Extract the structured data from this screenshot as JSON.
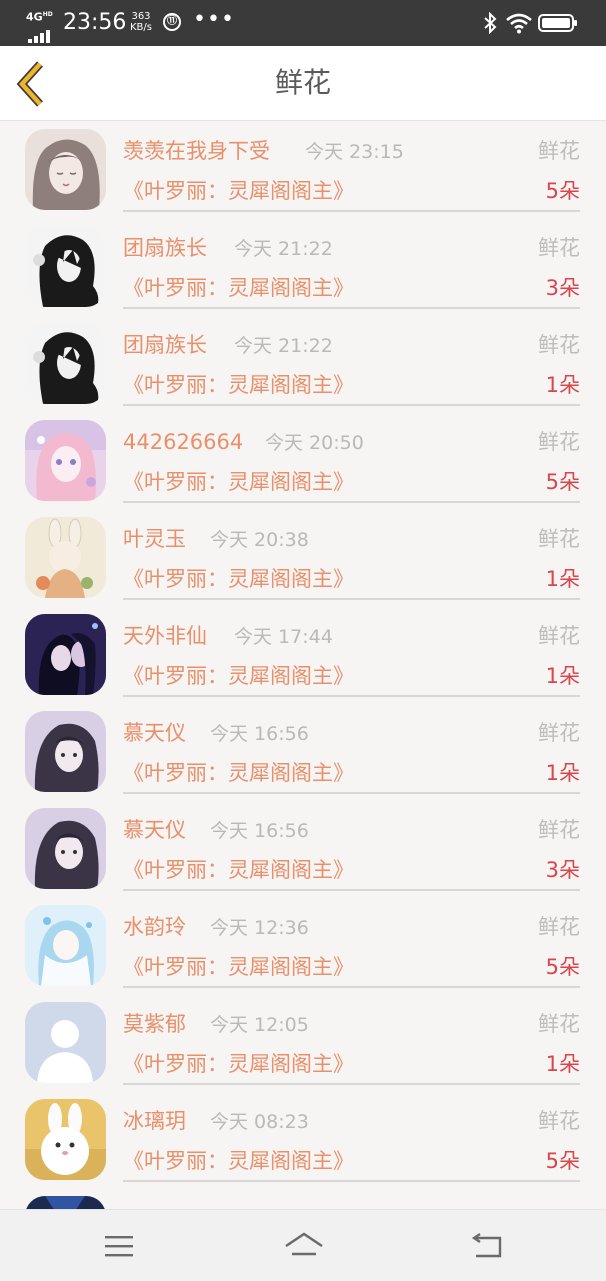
{
  "status_bar": {
    "network": "4G",
    "network_sup": "HD",
    "time": "23:56",
    "speed_value": "363",
    "speed_unit": "KB/s",
    "app_badge": "⑪",
    "more": "•••",
    "icons": [
      "signal-icon",
      "bluetooth-icon",
      "wifi-icon",
      "battery-icon"
    ]
  },
  "header": {
    "title": "鲜花",
    "back_icon": "chevron-left-icon",
    "accent_color": "#f0b429"
  },
  "colors": {
    "name": "#e8906a",
    "time": "#b9b9b9",
    "gift": "#bdbdbd",
    "quantity": "#d9454a"
  },
  "records": [
    {
      "name": "羡羡在我身下受",
      "time": "今天 23:15",
      "gift": "鲜花",
      "target": "《叶罗丽：灵犀阁阁主》",
      "quantity": "5朵",
      "avatar": "anime-girl-sketch"
    },
    {
      "name": "团扇族长",
      "time": "今天 21:22",
      "gift": "鲜花",
      "target": "《叶罗丽：灵犀阁阁主》",
      "quantity": "3朵",
      "avatar": "black-hair-sketch"
    },
    {
      "name": "团扇族长",
      "time": "今天 21:22",
      "gift": "鲜花",
      "target": "《叶罗丽：灵犀阁阁主》",
      "quantity": "1朵",
      "avatar": "black-hair-sketch"
    },
    {
      "name": "442626664",
      "time": "今天 20:50",
      "gift": "鲜花",
      "target": "《叶罗丽：灵犀阁阁主》",
      "quantity": "5朵",
      "avatar": "pink-anime"
    },
    {
      "name": "叶灵玉",
      "time": "今天 20:38",
      "gift": "鲜花",
      "target": "《叶罗丽：灵犀阁阁主》",
      "quantity": "1朵",
      "avatar": "bunny-girl"
    },
    {
      "name": "天外非仙",
      "time": "今天 17:44",
      "gift": "鲜花",
      "target": "《叶罗丽：灵犀阁阁主》",
      "quantity": "1朵",
      "avatar": "dark-couple"
    },
    {
      "name": "慕天仪",
      "time": "今天 16:56",
      "gift": "鲜花",
      "target": "《叶罗丽：灵犀阁阁主》",
      "quantity": "1朵",
      "avatar": "purple-girl"
    },
    {
      "name": "慕天仪",
      "time": "今天 16:56",
      "gift": "鲜花",
      "target": "《叶罗丽：灵犀阁阁主》",
      "quantity": "3朵",
      "avatar": "purple-girl"
    },
    {
      "name": "水韵玲",
      "time": "今天 12:36",
      "gift": "鲜花",
      "target": "《叶罗丽：灵犀阁阁主》",
      "quantity": "5朵",
      "avatar": "blue-fairy"
    },
    {
      "name": "莫紫郁",
      "time": "今天 12:05",
      "gift": "鲜花",
      "target": "《叶罗丽：灵犀阁阁主》",
      "quantity": "1朵",
      "avatar": "default-user"
    },
    {
      "name": "冰璃玥",
      "time": "今天 08:23",
      "gift": "鲜花",
      "target": "《叶罗丽：灵犀阁阁主》",
      "quantity": "5朵",
      "avatar": "white-rabbit"
    }
  ],
  "nav_bar": {
    "items": [
      "menu-icon",
      "home-icon",
      "back-icon"
    ]
  }
}
